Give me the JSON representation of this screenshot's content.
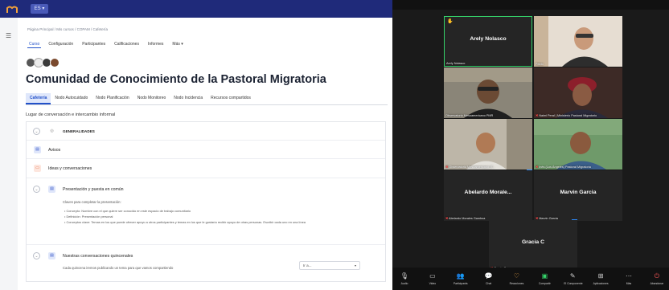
{
  "moodle": {
    "lang": "ES ▾",
    "breadcrumbs": [
      "Página Principal",
      "Mis cursos",
      "COPAM",
      "Cafetería"
    ],
    "nav_tabs": [
      "Curso",
      "Configuración",
      "Participantes",
      "Calificaciones",
      "Informes",
      "Más ▾"
    ],
    "course_title": "Comunidad de Conocimiento de la Pastoral Migratoria",
    "course_tabs": [
      "Cafetería",
      "Nodo Autocuidado",
      "Nodo Planificación",
      "Nodo Monitoreo",
      "Nodo Incidencia",
      "Recursos compartidos"
    ],
    "description": "Lugar de conversación e intercambio informal",
    "sections": {
      "generalidades": "GENERALIDADES",
      "avisos": "Avisos",
      "ideas": "Ideas y conversaciones",
      "presentacion": "Presentación y puesta en común",
      "presentacion_intro": "Claves para completar la presentación:",
      "presentacion_bullets": [
        "Concepto: Nombre con el que quiere ser conocido en este espacio de trabajo comunitario",
        "Definición: Presentación personal",
        "Conceptos clave: Temas en los que puede ofrecer apoyo a otros participantes y temas en los que le gustaría recibir apoyo de otras personas. Escribir cada uno en una línea"
      ],
      "quincenales": "Nuestras conversaciones quincenales",
      "quincenales_desc": "Cada quincena iremos publicando un tema para que vamos compartiendo"
    },
    "select_value": "Ir a..."
  },
  "zoom": {
    "participants": [
      {
        "name": "Arely Nolasco",
        "caption": "Arely Nolasco",
        "active": true,
        "hand": true
      },
      {
        "name": "",
        "caption": "Pablo",
        "active": false
      },
      {
        "name": "",
        "caption": "Observatorio Mesoamericano PMR",
        "active": false
      },
      {
        "name": "",
        "caption": "Naimi Peral | Ministerio Pastoral Migratorio",
        "active": false
      },
      {
        "name": "",
        "caption": "Observatorio Mesoamericano (T...",
        "active": false
      },
      {
        "name": "",
        "caption": "Inés (Los Ángeles) Pastoral Migratoria",
        "active": false
      },
      {
        "name": "Abelardo Morale...",
        "caption": "Abelardo Morales Gamboa",
        "active": false
      },
      {
        "name": "Marvin Garcia",
        "caption": "Marvin Garcia",
        "active": false
      },
      {
        "name": "Gracia C",
        "caption": "Gracia C",
        "active": false
      }
    ],
    "controls": [
      "Audio",
      "Video",
      "Participants",
      "Chat",
      "Reacciones",
      "Compartir",
      "El Componente",
      "Aplicaciones",
      "Más",
      "Abandonar"
    ]
  },
  "colors": {
    "moodle_topbar": "#1f2a7a",
    "moodle_accent": "#2251c9",
    "zoom_bg": "#1a1a1a",
    "zoom_active": "#35d36a",
    "mute_red": "#ff4a4a"
  }
}
